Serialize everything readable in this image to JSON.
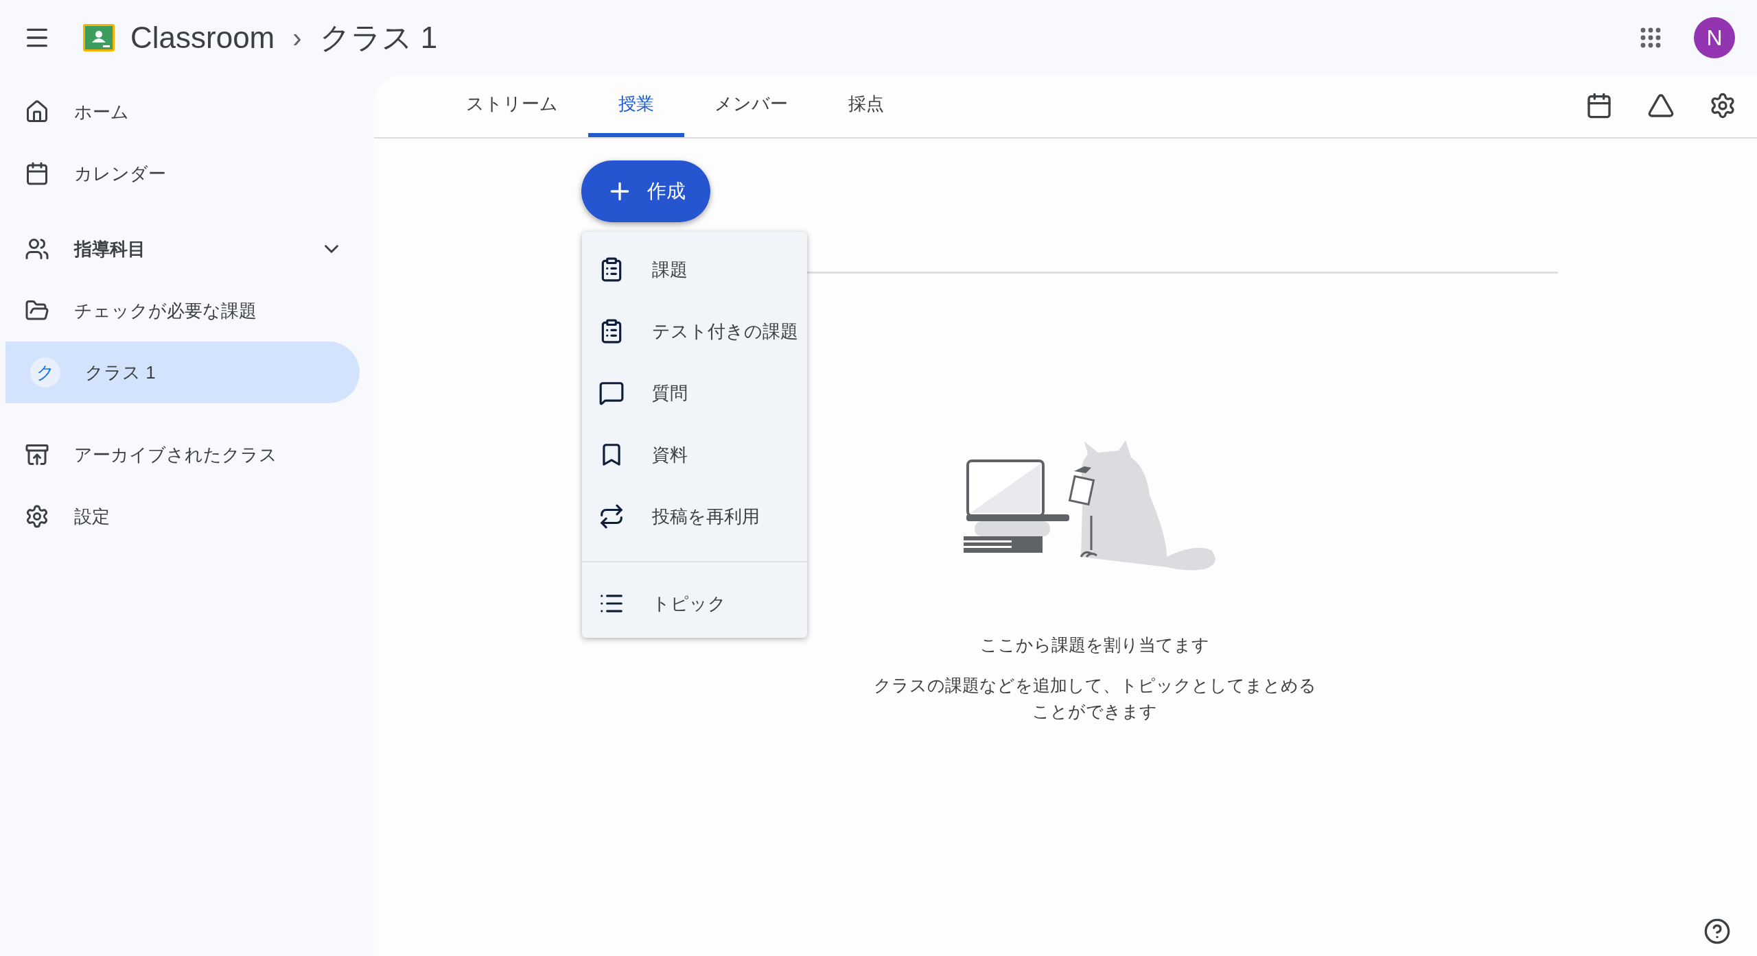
{
  "header": {
    "app_name": "Classroom",
    "breadcrumb_separator": "›",
    "class_name": "クラス 1",
    "avatar_letter": "N"
  },
  "sidebar": {
    "items": [
      {
        "kind": "link",
        "label": "ホーム",
        "selected": false
      },
      {
        "kind": "link",
        "label": "カレンダー",
        "selected": false
      },
      {
        "kind": "section",
        "label": "指導科目",
        "expanded": true,
        "selected": false
      },
      {
        "kind": "link",
        "label": "チェックが必要な課題",
        "selected": false
      },
      {
        "kind": "class",
        "label": "クラス 1",
        "avatar_letter": "ク",
        "selected": true
      },
      {
        "kind": "link",
        "label": "アーカイブされたクラス",
        "selected": false
      },
      {
        "kind": "link",
        "label": "設定",
        "selected": false
      }
    ]
  },
  "tabs": [
    {
      "label": "ストリーム",
      "selected": false
    },
    {
      "label": "授業",
      "selected": true
    },
    {
      "label": "メンバー",
      "selected": false
    },
    {
      "label": "採点",
      "selected": false
    }
  ],
  "create_button": {
    "label": "作成"
  },
  "create_menu": {
    "items": [
      {
        "label": "課題"
      },
      {
        "label": "テスト付きの課題"
      },
      {
        "label": "質問"
      },
      {
        "label": "資料"
      },
      {
        "label": "投稿を再利用"
      }
    ],
    "secondary_items": [
      {
        "label": "トピック"
      }
    ]
  },
  "empty_state": {
    "title": "ここから課題を割り当てます",
    "description": "クラスの課題などを追加して、トピックとしてまとめることができます"
  }
}
